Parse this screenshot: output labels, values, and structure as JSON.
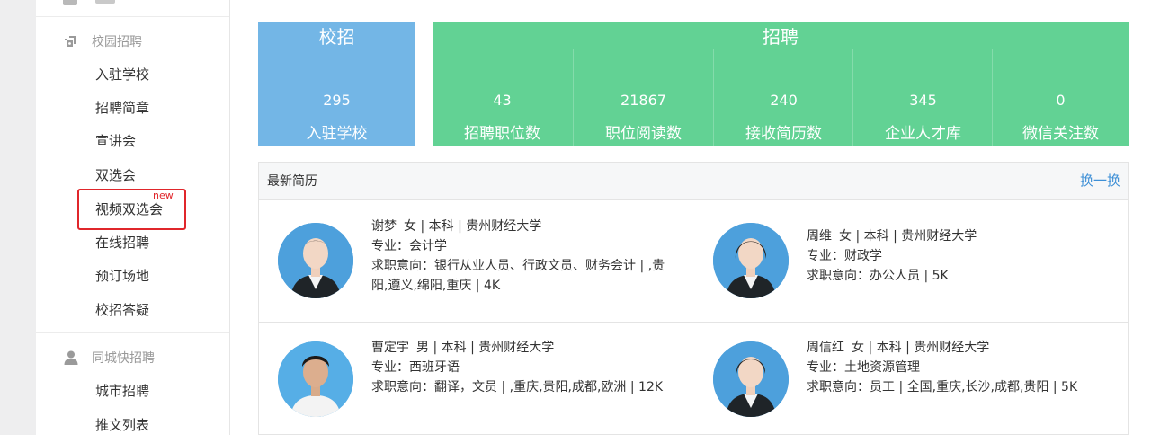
{
  "sidebar": {
    "groups": [
      {
        "label": "校园招聘",
        "icon": "campus-icon",
        "items": [
          "入驻学校",
          "招聘简章",
          "宣讲会",
          "双选会",
          "视频双选会",
          "在线招聘",
          "预订场地",
          "校招答疑"
        ]
      },
      {
        "label": "同城快招聘",
        "icon": "user-icon",
        "items": [
          "城市招聘",
          "推文列表"
        ]
      }
    ],
    "badge_new": "new"
  },
  "stats": {
    "campus": {
      "title": "校招",
      "value": "295",
      "label": "入驻学校"
    },
    "recruit": {
      "title": "招聘",
      "items": [
        {
          "value": "43",
          "label": "招聘职位数"
        },
        {
          "value": "21867",
          "label": "职位阅读数"
        },
        {
          "value": "240",
          "label": "接收简历数"
        },
        {
          "value": "345",
          "label": "企业人才库"
        },
        {
          "value": "0",
          "label": "微信关注数"
        }
      ]
    }
  },
  "resumes": {
    "title": "最新简历",
    "refresh_label": "换一换",
    "cards": [
      {
        "name": "谢梦",
        "summary": "女 | 本科 | 贵州财经大学",
        "major": "专业：会计学",
        "intent": "求职意向：银行从业人员、行政文员、财务会计 | ,贵阳,遵义,绵阳,重庆 | 4K"
      },
      {
        "name": "周维",
        "summary": "女 | 本科 | 贵州财经大学",
        "major": "专业：财政学",
        "intent": "求职意向：办公人员 | 5K"
      },
      {
        "name": "曹定宇",
        "summary": "男 | 本科 | 贵州财经大学",
        "major": "专业：西班牙语",
        "intent": "求职意向：翻译，文员 | ,重庆,贵阳,成都,欧洲 | 12K"
      },
      {
        "name": "周信红",
        "summary": "女 | 本科 | 贵州财经大学",
        "major": "专业：土地资源管理",
        "intent": "求职意向：员工 | 全国,重庆,长沙,成都,贵阳 | 5K"
      }
    ]
  },
  "colors": {
    "campus_blue": "#73b6e6",
    "recruit_green": "#62d294",
    "link_blue": "#3d8fd6",
    "highlight_red": "#e0262b",
    "avatar_blue": "#4da0dc"
  }
}
